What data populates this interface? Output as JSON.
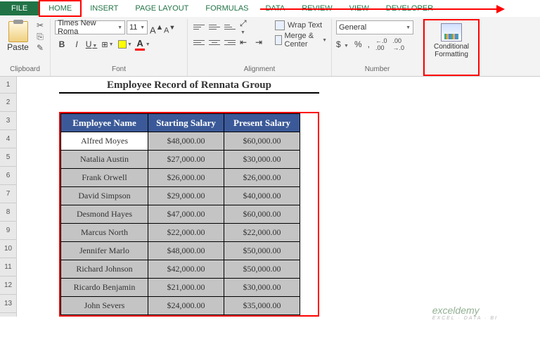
{
  "tabs": {
    "file": "FILE",
    "home": "HOME",
    "insert": "INSERT",
    "pagelayout": "PAGE LAYOUT",
    "formulas": "FORMULAS",
    "data": "DATA",
    "review": "REVIEW",
    "view": "VIEW",
    "developer": "DEVELOPER"
  },
  "ribbon": {
    "clipboard": {
      "paste": "Paste",
      "label": "Clipboard"
    },
    "font": {
      "name": "Times New Roma",
      "size": "11",
      "label": "Font"
    },
    "alignment": {
      "wrap": "Wrap Text",
      "merge": "Merge & Center",
      "label": "Alignment"
    },
    "number": {
      "format": "General",
      "dollar": "$",
      "percent": "%",
      "comma": ",",
      "inc": ".0",
      "dec": ".00",
      "label": "Number"
    },
    "condfmt": {
      "label": "Conditional Formatting"
    }
  },
  "sheet": {
    "title": "Employee Record of Rennata Group",
    "rows": [
      "1",
      "2",
      "3",
      "4",
      "5",
      "6",
      "7",
      "8",
      "9",
      "10",
      "11",
      "12",
      "13"
    ],
    "headers": [
      "Employee Name",
      "Starting Salary",
      "Present Salary"
    ],
    "data": [
      {
        "name": "Alfred Moyes",
        "start": "$48,000.00",
        "present": "$60,000.00"
      },
      {
        "name": "Natalia Austin",
        "start": "$27,000.00",
        "present": "$30,000.00"
      },
      {
        "name": "Frank Orwell",
        "start": "$26,000.00",
        "present": "$26,000.00"
      },
      {
        "name": "David Simpson",
        "start": "$29,000.00",
        "present": "$40,000.00"
      },
      {
        "name": "Desmond Hayes",
        "start": "$47,000.00",
        "present": "$60,000.00"
      },
      {
        "name": "Marcus North",
        "start": "$22,000.00",
        "present": "$22,000.00"
      },
      {
        "name": "Jennifer Marlo",
        "start": "$48,000.00",
        "present": "$50,000.00"
      },
      {
        "name": "Richard Johnson",
        "start": "$42,000.00",
        "present": "$50,000.00"
      },
      {
        "name": "Ricardo Benjamin",
        "start": "$21,000.00",
        "present": "$30,000.00"
      },
      {
        "name": "John Severs",
        "start": "$24,000.00",
        "present": "$35,000.00"
      }
    ]
  },
  "watermark": {
    "main": "exceldemy",
    "sub": "EXCEL · DATA · BI"
  }
}
